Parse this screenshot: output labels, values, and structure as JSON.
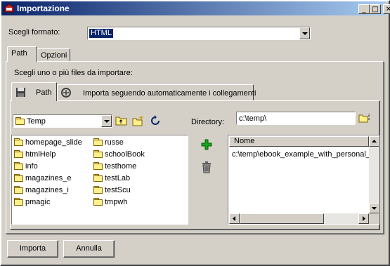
{
  "window": {
    "title": "Importazione",
    "controls": {
      "minimize": "_",
      "maximize": "□",
      "close": "✕"
    }
  },
  "format": {
    "label": "Scegli formato:",
    "value": "HTML"
  },
  "outer_tabs": [
    {
      "label": "Path",
      "selected": true
    },
    {
      "label": "Opzioni",
      "selected": false
    }
  ],
  "instruction": "Scegli uno o più files da importare:",
  "inner_tabs": [
    {
      "label": "Path",
      "icon": "floppy-disk-icon",
      "selected": true
    },
    {
      "label": "Importa seguendo automaticamente i collegamenti",
      "icon": "links-icon",
      "selected": false
    }
  ],
  "folder_select": {
    "value": "Temp",
    "icon": "folder-icon"
  },
  "folder_toolbar": {
    "up": "folder-up-icon",
    "new": "new-folder-icon",
    "refresh": "refresh-icon"
  },
  "directory": {
    "label": "Directory:",
    "value": "c:\\temp\\"
  },
  "folders_col1": [
    "homepage_slide",
    "htmlHelp",
    "info",
    "magazines_e",
    "magazines_i",
    "pmagic"
  ],
  "folders_col2": [
    "russe",
    "schoolBook",
    "testhome",
    "testLab",
    "testScu",
    "tmpwh"
  ],
  "files": {
    "column": "Nome",
    "rows": [
      "c:\\temp\\ebook_example_with_personal_pa"
    ]
  },
  "actions": {
    "add": "add-icon",
    "remove": "trash-icon"
  },
  "buttons": {
    "import": "Importa",
    "cancel": "Annulla"
  },
  "colors": {
    "title_start": "#0a246a",
    "title_end": "#a6caf0",
    "selection": "#0a246a",
    "face": "#d4d0c8"
  }
}
